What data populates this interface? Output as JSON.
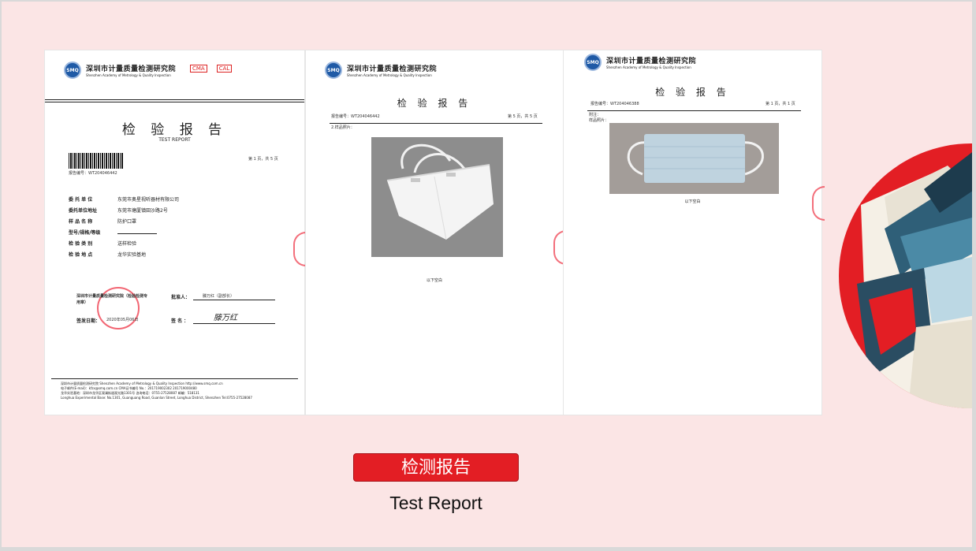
{
  "slide": {
    "title": "检测报告",
    "subtitle": "Test Report",
    "accent_color": "#e31e24",
    "background_color": "#fbe5e5"
  },
  "doc_common": {
    "org_cn": "深圳市计量质量检测研究院",
    "org_en": "Shenzhen Academy of Metrology & Quality Inspection",
    "logo_text": "SMQ",
    "report_title": "检 验 报 告"
  },
  "doc1": {
    "marks": [
      "CMA",
      "CAL"
    ],
    "report_title_en": "TEST REPORT",
    "report_no": "报告编号：WT204046442",
    "page_info": "第 1 页，共 5 页",
    "fields": [
      {
        "label": "委 托 单 位",
        "value": "东莞市奥星视听器材有限公司"
      },
      {
        "label": "委托单位地址",
        "value": "东莞市塘厦镇田沙路2号"
      },
      {
        "label": "样 品 名 称",
        "value": "防护口罩"
      },
      {
        "label": "型号/规格/等级",
        "value": ""
      },
      {
        "label": "检 验 类 别",
        "value": "送样检验"
      },
      {
        "label": "检 验 地 点",
        "value": "龙华实验基地"
      }
    ],
    "issuer_label": "深圳市计量质量检测研究院（检验检测专用章）",
    "approver_label": "批准人：",
    "approver_value": "滕万红（副部长）",
    "issue_date_label": "签发日期：",
    "issue_date_value": "2020年05月06日",
    "sign_label": "签 名 ：",
    "signature": "滕万红",
    "footer_lines": [
      "深圳市计量质量检测研究院    Shenzhen Academy of Metrology & Quality Inspection    http://www.smq.com.cn",
      "电子邮件(E-mail)：kfzx@smq.com.cn    CMA证书编号 No.：201719002302  201719000480",
      "龙华实验基地：深圳市龙华区观澜街道观光路1301号  咨询电话：0755-27528087  邮编：518131",
      "Longhua Experimental Base: No.1301, Guanguang Road, Guanlan Street, Longhua District, Shenzhen  Tel:0755-27528087"
    ]
  },
  "doc2": {
    "report_no": "报告编号：WT204046442",
    "page_info": "第 5 页，共 5 页",
    "section_label": "2.样品照片：",
    "photo_subject": "KN95 mask",
    "caption": "以下空白"
  },
  "doc3": {
    "report_no": "报告编号：WT204046388",
    "page_info": "第 1 页，共 1 页",
    "section_label_1": "附注：",
    "section_label_2": "样品照片：",
    "photo_subject": "surgical mask",
    "caption": "以下空白"
  }
}
